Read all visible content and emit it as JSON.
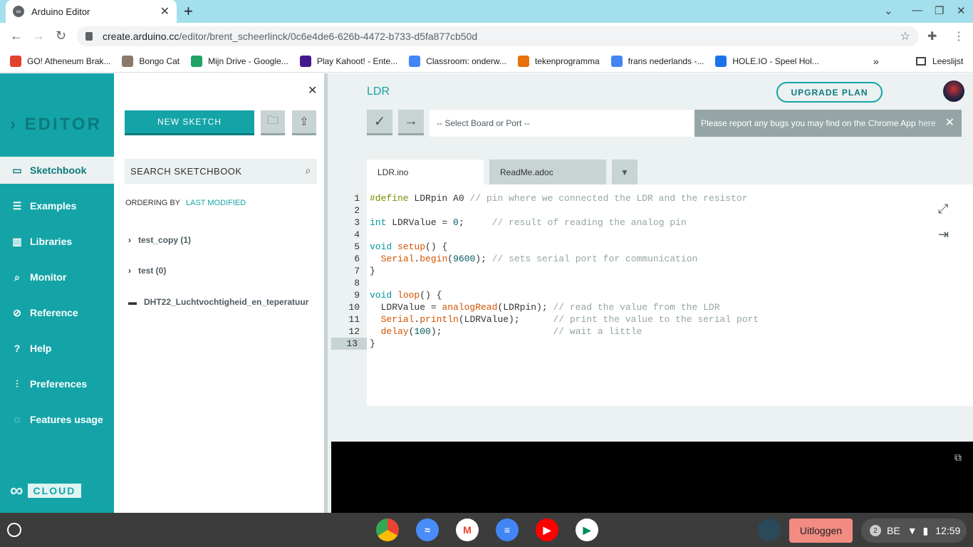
{
  "browser": {
    "tab_title": "Arduino Editor",
    "url_host": "create.arduino.cc",
    "url_path": "/editor/brent_scheerlinck/0c6e4de6-626b-4472-b733-d5fa877cb50d",
    "bookmarks": [
      {
        "label": "GO! Atheneum Brak...",
        "icon": "s-icon",
        "color": "#e2412e"
      },
      {
        "label": "Bongo Cat",
        "icon": "cat-icon",
        "color": "#8a7a6a"
      },
      {
        "label": "Mijn Drive - Google...",
        "icon": "drive-icon",
        "color": "#1fa463"
      },
      {
        "label": "Play Kahoot! - Ente...",
        "icon": "kahoot-icon",
        "color": "#46178f"
      },
      {
        "label": "Classroom: onderw...",
        "icon": "google-icon",
        "color": "#4285f4"
      },
      {
        "label": "tekenprogramma",
        "icon": "paint-icon",
        "color": "#e8710a"
      },
      {
        "label": "frans nederlands -...",
        "icon": "google-icon",
        "color": "#4285f4"
      },
      {
        "label": "HOLE.IO - Speel Hol...",
        "icon": "hole-icon",
        "color": "#1a73e8"
      }
    ],
    "reading_list": "Leeslijst"
  },
  "nav": {
    "logo": "EDITOR",
    "items": [
      {
        "label": "Sketchbook",
        "icon": "folder-icon"
      },
      {
        "label": "Examples",
        "icon": "list-icon"
      },
      {
        "label": "Libraries",
        "icon": "library-icon"
      },
      {
        "label": "Monitor",
        "icon": "monitor-icon"
      },
      {
        "label": "Reference",
        "icon": "compass-icon"
      },
      {
        "label": "Help",
        "icon": "help-icon"
      },
      {
        "label": "Preferences",
        "icon": "sliders-icon"
      },
      {
        "label": "Features usage",
        "icon": "usage-icon"
      }
    ],
    "cloud": "CLOUD"
  },
  "sketchbook": {
    "new_sketch": "NEW SKETCH",
    "search_placeholder": "SEARCH SKETCHBOOK",
    "ordering_by": "ORDERING BY",
    "ordering_value": "LAST MODIFIED",
    "items": [
      {
        "label": "test_copy (1)"
      },
      {
        "label": "test (0)"
      },
      {
        "label": "DHT22_Luchtvochtigheid_en_teperatuur"
      }
    ]
  },
  "editor": {
    "sketch_name": "LDR",
    "upgrade": "UPGRADE PLAN",
    "board_select": "-- Select Board or Port --",
    "bug_notice": "Please report any bugs you may find on the Chrome App",
    "bug_link": "here",
    "tabs": [
      "LDR.ino",
      "ReadMe.adoc"
    ],
    "line_numbers": [
      "1",
      "2",
      "3",
      "4",
      "5",
      "6",
      "7",
      "8",
      "9",
      "10",
      "11",
      "12",
      "13"
    ],
    "current_line": "13"
  },
  "shelf": {
    "logout": "Uitloggen",
    "notifications": "2",
    "keyboard": "BE",
    "time": "12:59"
  }
}
